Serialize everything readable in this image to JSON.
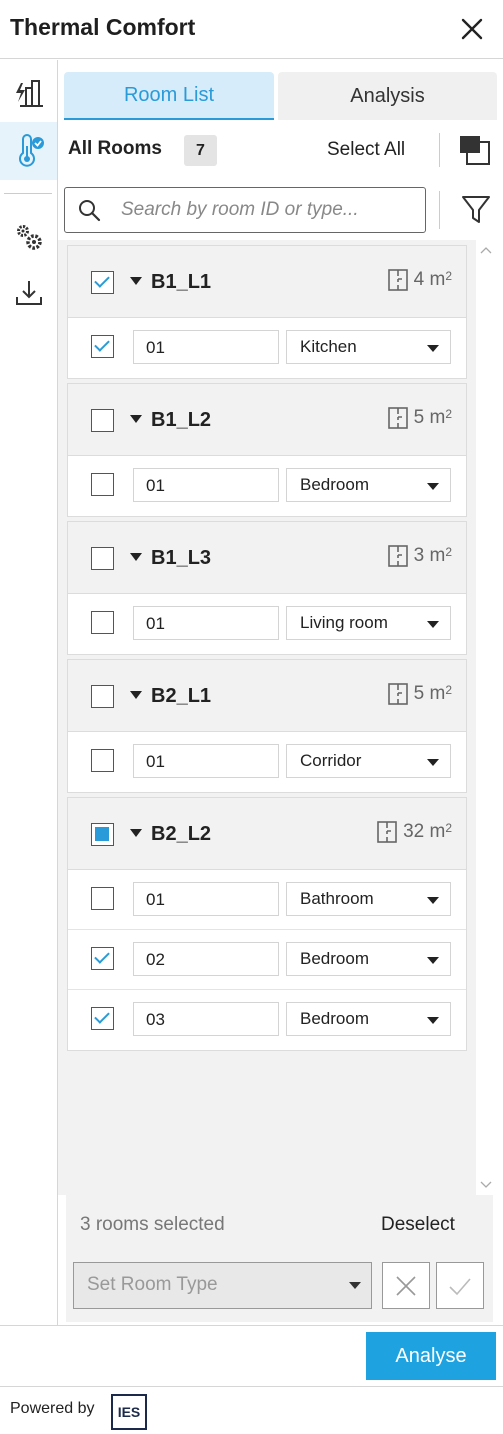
{
  "header": {
    "title": "Thermal Comfort"
  },
  "sidebar": {
    "items": [
      {
        "name": "energy-building-icon"
      },
      {
        "name": "thermal-comfort-icon",
        "active": true
      },
      {
        "name": "settings-icon"
      },
      {
        "name": "download-icon"
      }
    ]
  },
  "tabs": {
    "room_list": "Room List",
    "analysis": "Analysis"
  },
  "list_header": {
    "title": "All Rooms",
    "count": "7",
    "select_all": "Select All"
  },
  "search": {
    "placeholder": "Search by room ID or type..."
  },
  "groups": [
    {
      "name": "B1_L1",
      "area": "4 m",
      "area_unit_exp": "2",
      "state": "checked",
      "rooms": [
        {
          "id": "01",
          "type": "Kitchen",
          "checked": true
        }
      ]
    },
    {
      "name": "B1_L2",
      "area": "5 m",
      "area_unit_exp": "2",
      "state": "unchecked",
      "rooms": [
        {
          "id": "01",
          "type": "Bedroom",
          "checked": false
        }
      ]
    },
    {
      "name": "B1_L3",
      "area": "3 m",
      "area_unit_exp": "2",
      "state": "unchecked",
      "rooms": [
        {
          "id": "01",
          "type": "Living room",
          "checked": false
        }
      ]
    },
    {
      "name": "B2_L1",
      "area": "5 m",
      "area_unit_exp": "2",
      "state": "unchecked",
      "rooms": [
        {
          "id": "01",
          "type": "Corridor",
          "checked": false
        }
      ]
    },
    {
      "name": "B2_L2",
      "area": "32 m",
      "area_unit_exp": "2",
      "state": "partial",
      "rooms": [
        {
          "id": "01",
          "type": "Bathroom",
          "checked": false
        },
        {
          "id": "02",
          "type": "Bedroom",
          "checked": true
        },
        {
          "id": "03",
          "type": "Bedroom",
          "checked": true
        }
      ]
    }
  ],
  "footer": {
    "selected_text": "3 rooms selected",
    "deselect": "Deselect",
    "set_room_type_placeholder": "Set Room Type",
    "analyse": "Analyse",
    "powered_by": "Powered by",
    "logo_text": "IES"
  },
  "colors": {
    "accent": "#2a9bd8",
    "analyse_button": "#1fa3e0",
    "tab_active_bg": "#d6ecfa"
  }
}
